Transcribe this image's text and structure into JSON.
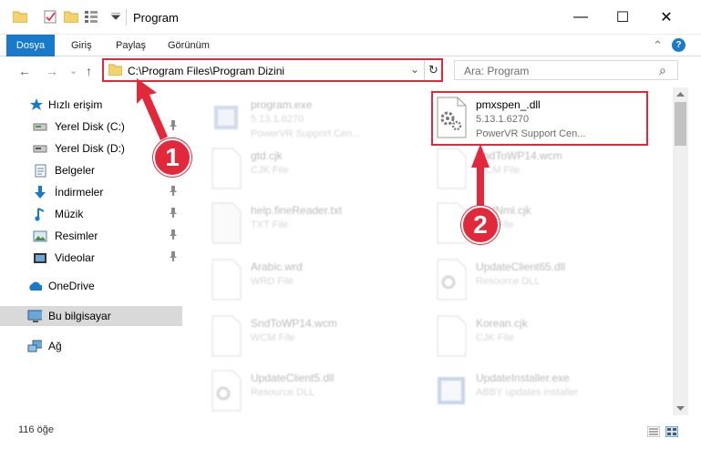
{
  "window": {
    "title": "Program",
    "minimize_glyph": "—",
    "maximize_glyph": "☐",
    "close_glyph": "✕"
  },
  "ribbon": {
    "tabs": [
      "Dosya",
      "Giriş",
      "Paylaş",
      "Görünüm"
    ],
    "help_glyph": "?",
    "collapse_glyph": "⌃"
  },
  "navigation": {
    "back_glyph": "←",
    "forward_glyph": "→",
    "recent_glyph": "⌄",
    "up_glyph": "↑",
    "address": "C:\\Program Files\\Program Dizini",
    "refresh_glyph": "↻",
    "dropdown_glyph": "⌄",
    "search_placeholder": "Ara: Program",
    "search_glyph": "⌕"
  },
  "sidebar": {
    "items": [
      {
        "label": "Hızlı erişim",
        "icon": "star-icon",
        "pinned": false
      },
      {
        "label": "Yerel Disk (C:)",
        "icon": "drive-icon",
        "pinned": true
      },
      {
        "label": "Yerel Disk (D:)",
        "icon": "drive-icon",
        "pinned": false
      },
      {
        "label": "Belgeler",
        "icon": "documents-icon",
        "pinned": true
      },
      {
        "label": "İndirmeler",
        "icon": "download-icon",
        "pinned": true
      },
      {
        "label": "Müzik",
        "icon": "music-icon",
        "pinned": true
      },
      {
        "label": "Resimler",
        "icon": "pictures-icon",
        "pinned": true
      },
      {
        "label": "Videolar",
        "icon": "videos-icon",
        "pinned": true
      },
      {
        "label": "OneDrive",
        "icon": "cloud-icon",
        "pinned": false
      },
      {
        "label": "Bu bilgisayar",
        "icon": "computer-icon",
        "pinned": false
      },
      {
        "label": "Ağ",
        "icon": "network-icon",
        "pinned": false
      }
    ],
    "pin_glyph": "📌"
  },
  "files": [
    {
      "name": "program.exe",
      "version": "5.13.1.6270",
      "desc": "PowerVR Support Cen...",
      "icon": "exe-icon",
      "faded": true
    },
    {
      "name": "pmxspen_.dll",
      "version": "5.13.1.6270",
      "desc": "PowerVR Support Cen...",
      "icon": "dll-icon",
      "faded": false
    },
    {
      "name": "gtd.cjk",
      "version": "CJK File",
      "desc": "",
      "icon": "blank-file-icon",
      "faded": true
    },
    {
      "name": "SndToWP14.wcm",
      "version": "WCM File",
      "desc": "",
      "icon": "blank-file-icon",
      "faded": true
    },
    {
      "name": "help.fineReader.txt",
      "version": "TXT File",
      "desc": "",
      "icon": "text-file-icon",
      "faded": true
    },
    {
      "name": "SndNml.cjk",
      "version": "CJK File",
      "desc": "",
      "icon": "blank-file-icon",
      "faded": true
    },
    {
      "name": "Arabic.wrd",
      "version": "WRD File",
      "desc": "",
      "icon": "blank-file-icon",
      "faded": true
    },
    {
      "name": "UpdateClient65.dll",
      "version": "Resource DLL",
      "desc": "",
      "icon": "dll-icon",
      "faded": true
    },
    {
      "name": "SndToWP14.wcm",
      "version": "WCM File",
      "desc": "",
      "icon": "blank-file-icon",
      "faded": true
    },
    {
      "name": "Korean.cjk",
      "version": "CJK File",
      "desc": "",
      "icon": "blank-file-icon",
      "faded": true
    },
    {
      "name": "UpdateClient5.dll",
      "version": "Resource DLL",
      "desc": "",
      "icon": "dll-icon",
      "faded": true
    },
    {
      "name": "UpdateInstaller.exe",
      "version": "ABBY updates installer",
      "desc": "",
      "icon": "installer-icon",
      "faded": true
    }
  ],
  "callouts": [
    "1",
    "2"
  ],
  "status": {
    "count": "116 öğe"
  },
  "colors": {
    "accent": "#1979ca",
    "highlight": "#e2293c"
  }
}
